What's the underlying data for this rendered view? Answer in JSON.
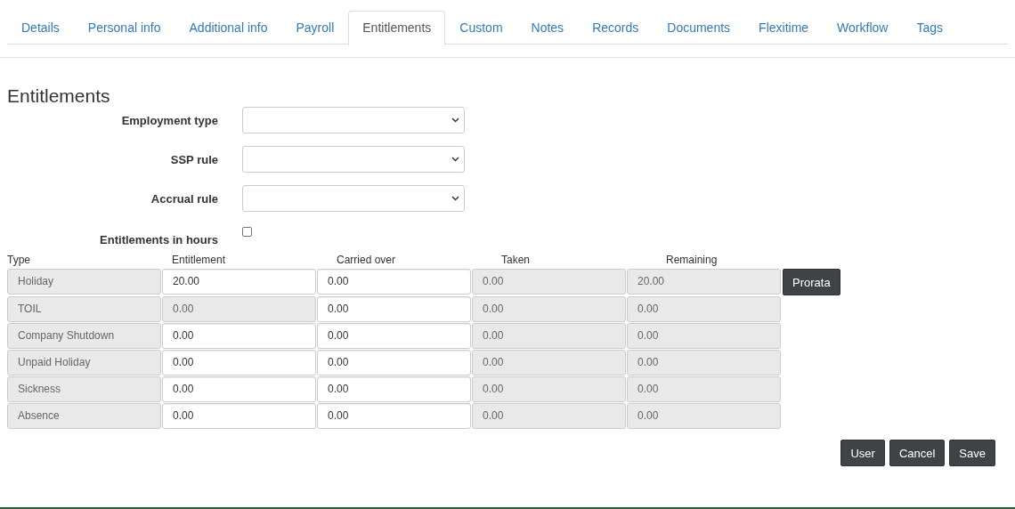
{
  "tabs": [
    {
      "label": "Details",
      "selected": false
    },
    {
      "label": "Personal info",
      "selected": false
    },
    {
      "label": "Additional info",
      "selected": false
    },
    {
      "label": "Payroll",
      "selected": false
    },
    {
      "label": "Entitlements",
      "selected": true
    },
    {
      "label": "Custom",
      "selected": false
    },
    {
      "label": "Notes",
      "selected": false
    },
    {
      "label": "Records",
      "selected": false
    },
    {
      "label": "Documents",
      "selected": false
    },
    {
      "label": "Flexitime",
      "selected": false
    },
    {
      "label": "Workflow",
      "selected": false
    },
    {
      "label": "Tags",
      "selected": false
    }
  ],
  "heading": "Entitlements",
  "form": [
    {
      "kind": "select",
      "label": "Employment type"
    },
    {
      "kind": "select",
      "label": "SSP rule"
    },
    {
      "kind": "select",
      "label": "Accrual rule"
    },
    {
      "kind": "checkbox",
      "label": "Entitlements in hours",
      "checked": false
    }
  ],
  "table": {
    "columns": [
      "Type",
      "Entitlement",
      "Carried over",
      "Taken",
      "Remaining"
    ],
    "rows": [
      {
        "cells": [
          {
            "value": "Holiday",
            "editable": false
          },
          {
            "value": "20.00",
            "editable": true
          },
          {
            "value": "0.00",
            "editable": true
          },
          {
            "value": "0.00",
            "editable": false
          },
          {
            "value": "20.00",
            "editable": false
          }
        ],
        "action": "Prorata"
      },
      {
        "cells": [
          {
            "value": "TOIL",
            "editable": false
          },
          {
            "value": "0.00",
            "editable": false
          },
          {
            "value": "0.00",
            "editable": true
          },
          {
            "value": "0.00",
            "editable": false
          },
          {
            "value": "0.00",
            "editable": false
          }
        ]
      },
      {
        "cells": [
          {
            "value": "Company Shutdown",
            "editable": false
          },
          {
            "value": "0.00",
            "editable": true
          },
          {
            "value": "0.00",
            "editable": true
          },
          {
            "value": "0.00",
            "editable": false
          },
          {
            "value": "0.00",
            "editable": false
          }
        ]
      },
      {
        "cells": [
          {
            "value": "Unpaid Holiday",
            "editable": false
          },
          {
            "value": "0.00",
            "editable": true
          },
          {
            "value": "0.00",
            "editable": true
          },
          {
            "value": "0.00",
            "editable": false
          },
          {
            "value": "0.00",
            "editable": false
          }
        ]
      },
      {
        "cells": [
          {
            "value": "Sickness",
            "editable": false
          },
          {
            "value": "0.00",
            "editable": true
          },
          {
            "value": "0.00",
            "editable": true
          },
          {
            "value": "0.00",
            "editable": false
          },
          {
            "value": "0.00",
            "editable": false
          }
        ]
      },
      {
        "cells": [
          {
            "value": "Absence",
            "editable": false
          },
          {
            "value": "0.00",
            "editable": true
          },
          {
            "value": "0.00",
            "editable": true
          },
          {
            "value": "0.00",
            "editable": false
          },
          {
            "value": "0.00",
            "editable": false
          }
        ]
      }
    ]
  },
  "buttons": [
    "User",
    "Cancel",
    "Save"
  ]
}
